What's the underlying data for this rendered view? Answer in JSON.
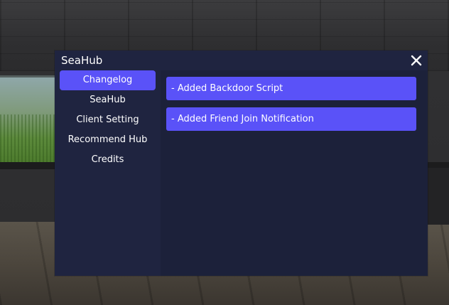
{
  "window": {
    "title": "SeaHub",
    "close_icon": "close-icon"
  },
  "sidebar": {
    "items": [
      {
        "label": "Changelog",
        "active": true
      },
      {
        "label": "SeaHub",
        "active": false
      },
      {
        "label": "Client Setting",
        "active": false
      },
      {
        "label": "Recommend Hub",
        "active": false
      },
      {
        "label": "Credits",
        "active": false
      }
    ]
  },
  "changelog": {
    "entries": [
      "- Added Backdoor Script",
      "- Added Friend Join Notification"
    ]
  },
  "colors": {
    "panel": "#1f2440",
    "content": "#1c213a",
    "accent": "#5a52f8",
    "text": "#ffffff"
  }
}
